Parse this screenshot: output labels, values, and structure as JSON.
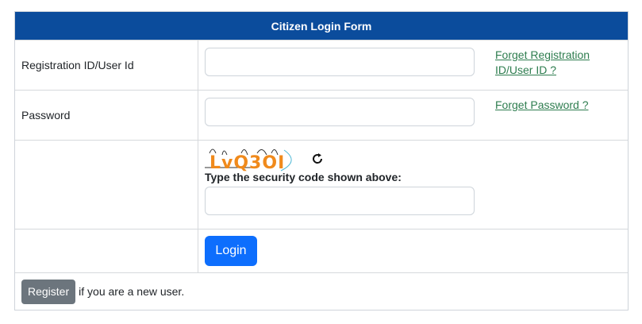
{
  "form": {
    "title": "Citizen Login Form",
    "user_id": {
      "label": "Registration ID/User Id",
      "value": "",
      "placeholder": "",
      "forget_link_line1": "Forget Registration",
      "forget_link_line2": "ID/User ID ?"
    },
    "password": {
      "label": "Password",
      "value": "",
      "placeholder": "",
      "forget_link": "Forget Password ?"
    },
    "captcha": {
      "code": "LvQ3OI",
      "instruction": "Type the security code shown above:",
      "value": "",
      "refresh_icon": "refresh-icon"
    },
    "login_label": "Login",
    "register_label": "Register",
    "register_note": "if you are a new user."
  },
  "colors": {
    "header_bg": "#0b4c9c",
    "link": "#2e7d4f",
    "login_btn": "#0d6efd",
    "register_btn": "#6c757d",
    "captcha_text": "#f08a1c"
  }
}
